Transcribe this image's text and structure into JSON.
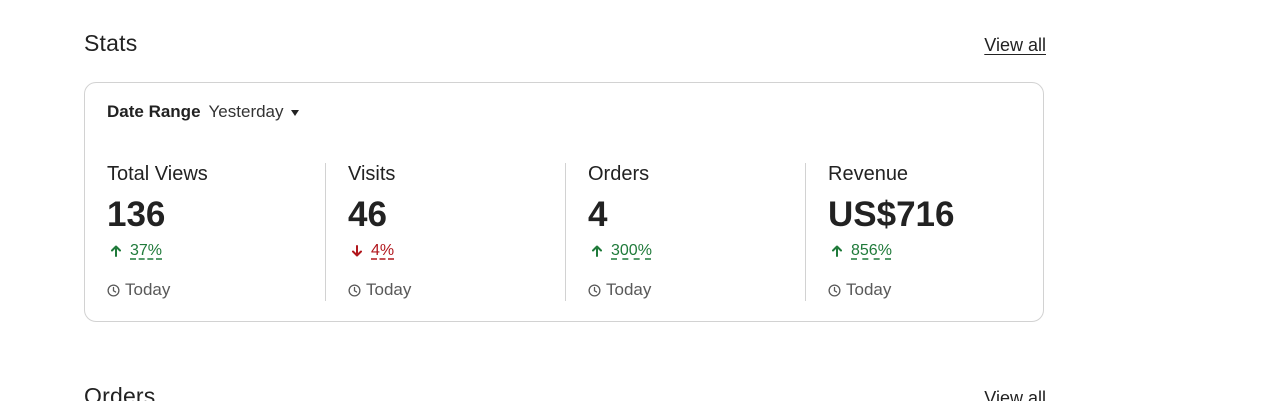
{
  "stats": {
    "title": "Stats",
    "view_all": "View all",
    "date_range": {
      "label": "Date Range",
      "selected": "Yesterday"
    },
    "metrics": [
      {
        "label": "Total Views",
        "value": "136",
        "change": "37%",
        "direction": "up",
        "period": "Today"
      },
      {
        "label": "Visits",
        "value": "46",
        "change": "4%",
        "direction": "down",
        "period": "Today"
      },
      {
        "label": "Orders",
        "value": "4",
        "change": "300%",
        "direction": "up",
        "period": "Today"
      },
      {
        "label": "Revenue",
        "value": "US$716",
        "change": "856%",
        "direction": "up",
        "period": "Today"
      }
    ]
  },
  "orders": {
    "title": "Orders",
    "view_all": "View all"
  },
  "colors": {
    "positive": "#1f7a3a",
    "negative": "#b1161c",
    "border": "#d2d2d2"
  },
  "icons": {
    "up": "arrow-up-icon",
    "down": "arrow-down-icon",
    "period": "clock-icon",
    "dropdown": "caret-down-icon"
  }
}
